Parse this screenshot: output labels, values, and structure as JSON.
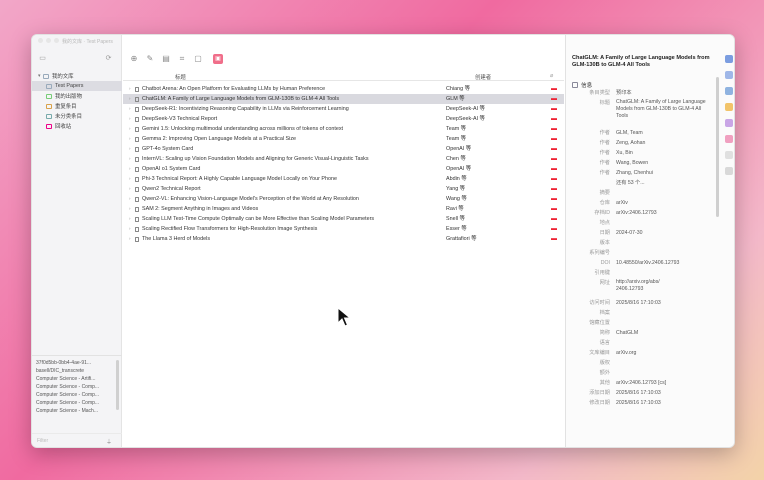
{
  "nav_caption": "我的文库 · Test Papers",
  "sidebar": {
    "items": [
      {
        "label": "我的文库",
        "level": 0,
        "selected": false,
        "icon": "library-icon"
      },
      {
        "label": "Test Papers",
        "level": 1,
        "selected": true,
        "icon": "folder-icon"
      },
      {
        "label": "我的出版物",
        "level": 1,
        "selected": false,
        "icon": "publications-icon"
      },
      {
        "label": "重复条目",
        "level": 1,
        "selected": false,
        "icon": "duplicates-icon"
      },
      {
        "label": "未分类条目",
        "level": 1,
        "selected": false,
        "icon": "unfiled-icon"
      },
      {
        "label": "回收站",
        "level": 1,
        "selected": false,
        "icon": "trash-icon"
      }
    ],
    "tags": [
      "37f0d5bb-0bb4-4ae-91...",
      "basell/DIC_transcrete",
      "Computer Science - Artifi...",
      "Computer Science - Comp...",
      "Computer Science - Comp...",
      "Computer Science - Comp...",
      "Computer Science - Mach..."
    ],
    "filter_placeholder": "Filter"
  },
  "columns": {
    "title": "标题",
    "creator": "创建者"
  },
  "rows": [
    {
      "title": "Chatbot Arena: An Open Platform for Evaluating LLMs by Human Preference",
      "creator": "Chiang 等",
      "selected": false
    },
    {
      "title": "ChatGLM: A Family of Large Language Models from GLM-130B to GLM-4 All Tools",
      "creator": "GLM 等",
      "selected": true
    },
    {
      "title": "DeepSeek-R1: Incentivizing Reasoning Capability in LLMs via Reinforcement Learning",
      "creator": "DeepSeek-AI 等",
      "selected": false
    },
    {
      "title": "DeepSeek-V3 Technical Report",
      "creator": "DeepSeek-AI 等",
      "selected": false
    },
    {
      "title": "Gemini 1.5: Unlocking multimodal understanding across millions of tokens of context",
      "creator": "Team 等",
      "selected": false
    },
    {
      "title": "Gemma 2: Improving Open Language Models at a Practical Size",
      "creator": "Team 等",
      "selected": false
    },
    {
      "title": "GPT-4o System Card",
      "creator": "OpenAI 等",
      "selected": false
    },
    {
      "title": "InternVL: Scaling up Vision Foundation Models and Aligning for Generic Visual-Linguistic Tasks",
      "creator": "Chen 等",
      "selected": false
    },
    {
      "title": "OpenAI o1 System Card",
      "creator": "OpenAI 等",
      "selected": false
    },
    {
      "title": "Phi-3 Technical Report: A Highly Capable Language Model Locally on Your Phone",
      "creator": "Abdin 等",
      "selected": false
    },
    {
      "title": "Qwen2 Technical Report",
      "creator": "Yang 等",
      "selected": false
    },
    {
      "title": "Qwen2-VL: Enhancing Vision-Language Model's Perception of the World at Any Resolution",
      "creator": "Wang 等",
      "selected": false
    },
    {
      "title": "SAM 2: Segment Anything in Images and Videos",
      "creator": "Ravi 等",
      "selected": false
    },
    {
      "title": "Scaling LLM Test-Time Compute Optimally can be More Effective than Scaling Model Parameters",
      "creator": "Snell 等",
      "selected": false
    },
    {
      "title": "Scaling Rectified Flow Transformers for High-Resolution Image Synthesis",
      "creator": "Esser 等",
      "selected": false
    },
    {
      "title": "The Llama 3 Herd of Models",
      "creator": "Grattafiori 等",
      "selected": false
    }
  ],
  "item": {
    "title": "ChatGLM: A Family of Large Language Models from GLM-130B to GLM-4 All Tools",
    "section": "信息",
    "fields": [
      {
        "label": "条目类型",
        "value": "预印本"
      },
      {
        "label": "标题",
        "value": "ChatGLM: A Family of Large Language Models from GLM-130B to GLM-4 All Tools",
        "multiline": true
      },
      {
        "label": "作者",
        "value": "GLM, Team"
      },
      {
        "label": "作者",
        "value": "Zeng, Aohan"
      },
      {
        "label": "作者",
        "value": "Xu, Bin"
      },
      {
        "label": "作者",
        "value": "Wang, Bowen"
      },
      {
        "label": "作者",
        "value": "Zhang, Chenhui"
      },
      {
        "label": "",
        "value": "还有 53 个..."
      },
      {
        "label": "摘要",
        "value": ""
      },
      {
        "label": "仓库",
        "value": "arXiv"
      },
      {
        "label": "存档ID",
        "value": "arXiv:2406.12793"
      },
      {
        "label": "地点",
        "value": ""
      },
      {
        "label": "日期",
        "value": "2024-07-30"
      },
      {
        "label": "版本",
        "value": ""
      },
      {
        "label": "系列编号",
        "value": ""
      },
      {
        "label": "DOI",
        "value": "10.48550/arXiv.2406.12793"
      },
      {
        "label": "引用键",
        "value": ""
      },
      {
        "label": "网址",
        "value": "http://arxiv.org/abs/2406.12793"
      },
      {
        "label": "访问时间",
        "value": "2025/8/16 17:10:03"
      },
      {
        "label": "档案",
        "value": ""
      },
      {
        "label": "馆藏位置",
        "value": ""
      },
      {
        "label": "简称",
        "value": "ChatGLM"
      },
      {
        "label": "语言",
        "value": ""
      },
      {
        "label": "文库编目",
        "value": "arXiv.org"
      },
      {
        "label": "版权",
        "value": ""
      },
      {
        "label": "额外",
        "value": ""
      },
      {
        "label": "其他",
        "value": "arXiv:2406.12793 [cs]"
      },
      {
        "label": "添加日期",
        "value": "2025/8/16 17:10:03"
      },
      {
        "label": "修改日期",
        "value": "2025/8/16 17:10:03"
      }
    ]
  },
  "colors": {
    "accent_pink": "#f06e8a",
    "selection": "#d9d9df",
    "attachment_red": "#e23333"
  }
}
